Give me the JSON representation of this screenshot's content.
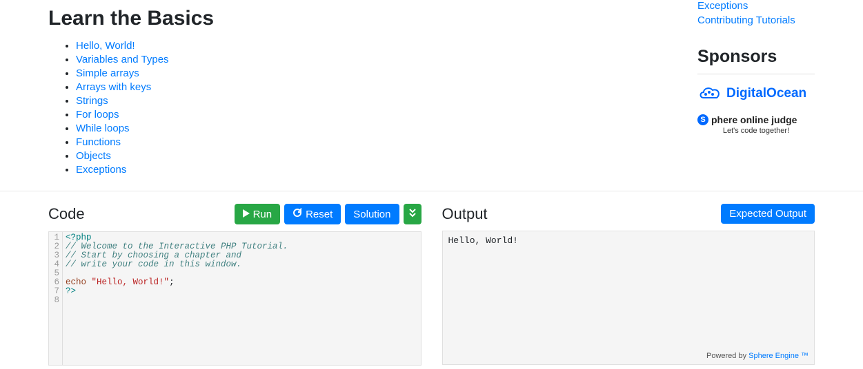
{
  "main": {
    "heading": "Learn the Basics",
    "basics": [
      "Hello, World!",
      "Variables and Types",
      "Simple arrays",
      "Arrays with keys",
      "Strings",
      "For loops",
      "While loops",
      "Functions",
      "Objects",
      "Exceptions"
    ]
  },
  "sidebar": {
    "top_links": [
      "Exceptions",
      "Contributing Tutorials"
    ],
    "sponsors_heading": "Sponsors",
    "sponsor1": "DigitalOcean",
    "sponsor2_line1": "phere online judge",
    "sponsor2_line2": "Let's code together!",
    "sponsor2_s": "S"
  },
  "code": {
    "panel_title": "Code",
    "run_label": "Run",
    "reset_label": "Reset",
    "solution_label": "Solution",
    "lines": {
      "l1_open": "<?php",
      "l2_comment": "// Welcome to the Interactive PHP Tutorial.",
      "l3_comment": "// Start by choosing a chapter and",
      "l4_comment": "// write your code in this window.",
      "l6_kw": "echo",
      "l6_str": "\"Hello, World!\"",
      "l6_semi": ";",
      "l7_close": "?>"
    }
  },
  "output": {
    "panel_title": "Output",
    "expected_label": "Expected Output",
    "text": "Hello, World!",
    "powered_prefix": "Powered by ",
    "powered_link": "Sphere Engine ™"
  }
}
